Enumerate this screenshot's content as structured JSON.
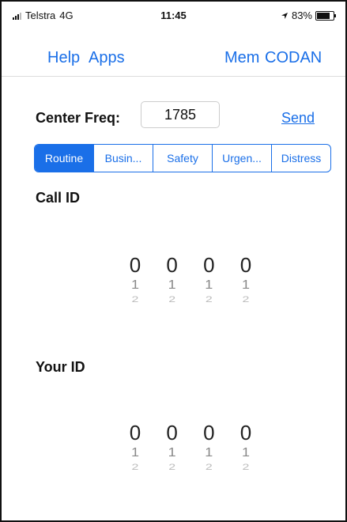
{
  "status_bar": {
    "carrier": "Telstra",
    "network": "4G",
    "time": "11:45",
    "battery": "83%"
  },
  "nav": {
    "help": "Help",
    "apps": "Apps",
    "mem": "Mem",
    "codan": "CODAN"
  },
  "freq": {
    "label": "Center Freq:",
    "value": "1785",
    "send_label": "Send"
  },
  "segments": [
    {
      "label": "Routine",
      "active": true
    },
    {
      "label": "Busin...",
      "active": false
    },
    {
      "label": "Safety",
      "active": false
    },
    {
      "label": "Urgen...",
      "active": false
    },
    {
      "label": "Distress",
      "active": false
    }
  ],
  "call_id": {
    "title": "Call ID",
    "wheels": [
      {
        "selected": "0",
        "next1": "1",
        "next2": "2"
      },
      {
        "selected": "0",
        "next1": "1",
        "next2": "2"
      },
      {
        "selected": "0",
        "next1": "1",
        "next2": "2"
      },
      {
        "selected": "0",
        "next1": "1",
        "next2": "2"
      }
    ]
  },
  "your_id": {
    "title": "Your ID",
    "wheels": [
      {
        "selected": "0",
        "next1": "1",
        "next2": "2"
      },
      {
        "selected": "0",
        "next1": "1",
        "next2": "2"
      },
      {
        "selected": "0",
        "next1": "1",
        "next2": "2"
      },
      {
        "selected": "0",
        "next1": "1",
        "next2": "2"
      }
    ]
  },
  "colors": {
    "accent": "#1a6fe8"
  },
  "icons": {
    "signal": "cell-signal-icon",
    "location": "location-arrow-icon",
    "battery": "battery-icon"
  }
}
